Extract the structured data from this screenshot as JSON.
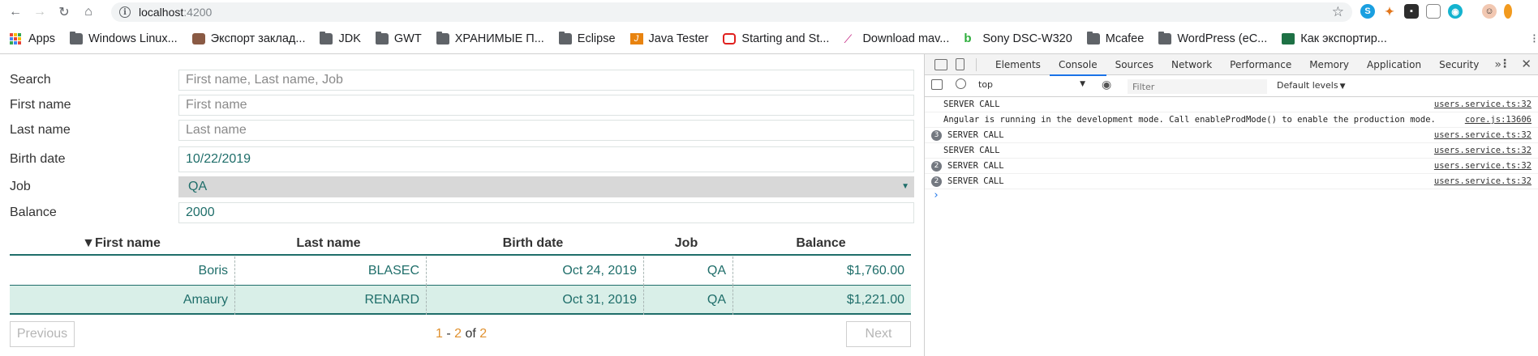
{
  "browser": {
    "url_host": "localhost",
    "url_port": ":4200",
    "bookmarks": [
      {
        "label": "Apps",
        "icon": "apps-grid-icon"
      },
      {
        "label": "Windows Linux...",
        "icon": "folder-icon"
      },
      {
        "label": "Экспорт заклад...",
        "icon": "bookmark-page-icon"
      },
      {
        "label": "JDK",
        "icon": "folder-icon"
      },
      {
        "label": "GWT",
        "icon": "folder-icon"
      },
      {
        "label": "ХРАНИМЫЕ П...",
        "icon": "folder-icon"
      },
      {
        "label": "Eclipse",
        "icon": "folder-icon"
      },
      {
        "label": "Java Tester",
        "icon": "java-icon"
      },
      {
        "label": "Starting and St...",
        "icon": "oracle-icon"
      },
      {
        "label": "Download mav...",
        "icon": "feather-icon"
      },
      {
        "label": "Sony DSC-W320",
        "icon": "b-icon"
      },
      {
        "label": "Mcafee",
        "icon": "folder-icon"
      },
      {
        "label": "WordPress (eC...",
        "icon": "folder-icon"
      },
      {
        "label": "Как экспортир...",
        "icon": "excel-icon"
      }
    ]
  },
  "form": {
    "search": {
      "label": "Search",
      "placeholder": "First name, Last name, Job",
      "value": ""
    },
    "first_name": {
      "label": "First name",
      "placeholder": "First name",
      "value": ""
    },
    "last_name": {
      "label": "Last name",
      "placeholder": "Last name",
      "value": ""
    },
    "birth_date": {
      "label": "Birth date",
      "value": "10/22/2019"
    },
    "job": {
      "label": "Job",
      "value": "QA"
    },
    "balance": {
      "label": "Balance",
      "value": "2000"
    }
  },
  "grid": {
    "headers": [
      "▼First name",
      "Last name",
      "Birth date",
      "Job",
      "Balance"
    ],
    "rows": [
      {
        "first_name": "Boris",
        "last_name": "BLASEC",
        "birth_date": "Oct 24, 2019",
        "job": "QA",
        "balance": "$1,760.00"
      },
      {
        "first_name": "Amaury",
        "last_name": "RENARD",
        "birth_date": "Oct 31, 2019",
        "job": "QA",
        "balance": "$1,221.00"
      }
    ]
  },
  "pager": {
    "previous": "Previous",
    "next": "Next",
    "from": "1",
    "dash": " - ",
    "to": "2",
    "of": " of ",
    "total": "2"
  },
  "devtools": {
    "tabs": [
      "Elements",
      "Console",
      "Sources",
      "Network",
      "Performance",
      "Memory",
      "Application",
      "Security"
    ],
    "active_tab": "Console",
    "context": "top",
    "filter_placeholder": "Filter",
    "levels": "Default levels",
    "log": [
      {
        "count": "",
        "message": "SERVER CALL",
        "source": "users.service.ts:32"
      },
      {
        "count": "",
        "message": "Angular is running in the development mode. Call enableProdMode() to enable the production mode.",
        "source": "core.js:13606"
      },
      {
        "count": "3",
        "message": "SERVER CALL",
        "source": "users.service.ts:32"
      },
      {
        "count": "",
        "message": "SERVER CALL",
        "source": "users.service.ts:32"
      },
      {
        "count": "2",
        "message": "SERVER CALL",
        "source": "users.service.ts:32"
      },
      {
        "count": "2",
        "message": "SERVER CALL",
        "source": "users.service.ts:32"
      }
    ],
    "prompt": "›"
  },
  "colors": {
    "accent": "#1f6e6a",
    "row_highlight": "#d9efe8",
    "pager_number": "#e0912f",
    "devtools_active": "#1a73e8"
  }
}
